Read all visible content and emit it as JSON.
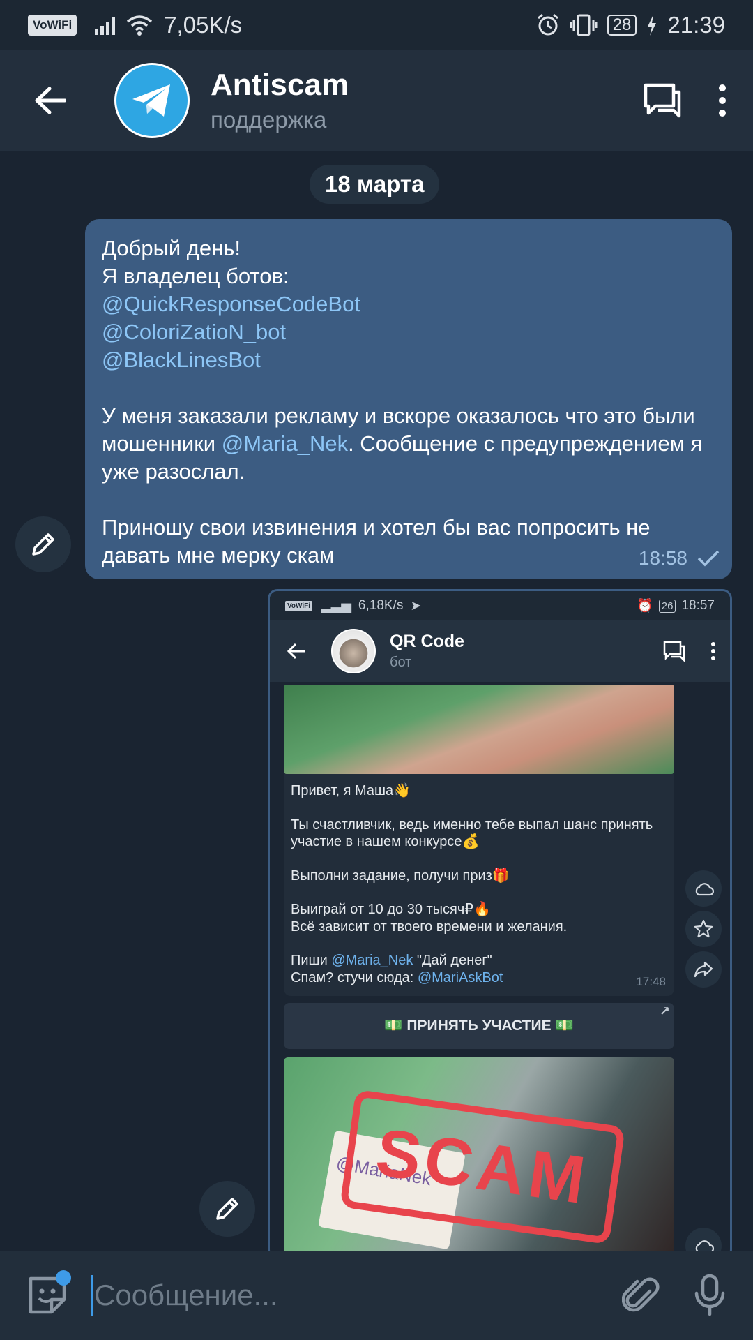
{
  "status_bar": {
    "vowifi": "VoWiFi",
    "speed": "7,05K/s",
    "battery": "28",
    "time": "21:39"
  },
  "header": {
    "title": "Antiscam",
    "subtitle": "поддержка"
  },
  "chat": {
    "date": "18 марта",
    "message": {
      "line1": "Добрый день!\nЯ владелец ботов:",
      "link1": "@QuickResponseCodeBot",
      "link2": "@ColoriZatioN_bot",
      "link3": "@BlackLinesBot",
      "para2_a": "У меня заказали рекламу и вскоре оказалось что это были мошенники ",
      "para2_link": "@Maria_Nek",
      "para2_b": ". Сообщение с предупреждением я уже разослал.",
      "para3": "Приношу свои извинения и хотел бы вас попросить не давать мне мерку скам",
      "time": "18:58"
    }
  },
  "screenshot": {
    "status": {
      "vowifi": "VoWiFi",
      "speed": "6,18K/s",
      "battery": "26",
      "time": "18:57"
    },
    "header": {
      "title": "QR Code",
      "subtitle": "бот"
    },
    "message": {
      "p1": "Привет, я Маша👋",
      "p2": "Ты счастливчик, ведь именно тебе выпал шанс принять участие в нашем конкурсе💰",
      "p3": "Выполни задание, получи приз🎁",
      "p4": "Выиграй от 10 до 30 тысяч₽🔥\nВсё зависит от твоего времени и желания.",
      "p5_a": "Пиши ",
      "p5_link": "@Maria_Nek",
      "p5_b": " \"Дай денег\"",
      "p6_a": "Спам? стучи сюда: ",
      "p6_link": "@MariAskBot",
      "time": "17:48"
    },
    "button": "💵 ПРИНЯТЬ УЧАСТИЕ 💵",
    "stamp": "SCAM",
    "card_text": "@MariaNek"
  },
  "input": {
    "placeholder": "Сообщение..."
  }
}
